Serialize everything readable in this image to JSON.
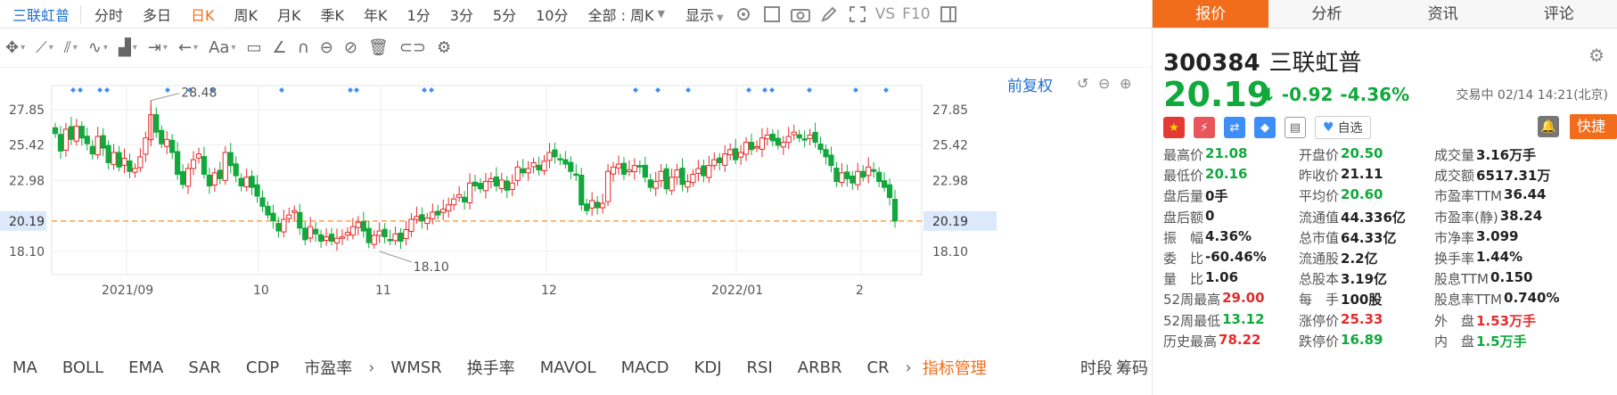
{
  "top": {
    "stock_name": "三联虹普",
    "timeframes": [
      "分时",
      "多日",
      "日K",
      "周K",
      "月K",
      "季K",
      "年K",
      "1分",
      "3分",
      "5分",
      "10分"
    ],
    "active_timeframe": "日K",
    "range_select": "全部 : 周K",
    "display_label": "显示",
    "vs_label": "VS",
    "f10_label": "F10"
  },
  "chart": {
    "adjust_label": "前复权",
    "y_ticks": [
      "27.85",
      "25.42",
      "22.98",
      "20.19",
      "18.10"
    ],
    "x_ticks": [
      "2021/09",
      "10",
      "11",
      "12",
      "2022/01",
      "2"
    ],
    "high_label": "28.48",
    "low_label": "18.10",
    "current_price_label": "20.19"
  },
  "chart_data": {
    "type": "candlestick",
    "ylim": [
      16.5,
      29.5
    ],
    "y_ticks": [
      27.85,
      25.42,
      22.98,
      20.19,
      18.1
    ],
    "x_ticks": [
      "2021/09",
      "10",
      "11",
      "12",
      "2022/01",
      "2"
    ],
    "current_price": 20.19,
    "max": 28.48,
    "min": 18.1,
    "closes": [
      26.2,
      25.0,
      26.5,
      25.8,
      26.7,
      25.9,
      25.5,
      24.8,
      26.0,
      25.2,
      24.2,
      24.9,
      23.9,
      24.5,
      23.6,
      23.8,
      24.6,
      25.9,
      27.5,
      26.3,
      25.5,
      25.8,
      24.9,
      23.4,
      22.7,
      23.8,
      24.4,
      24.8,
      23.4,
      22.6,
      23.5,
      23.1,
      24.9,
      24.0,
      23.3,
      22.6,
      23.2,
      22.5,
      21.9,
      21.2,
      20.6,
      20.2,
      19.5,
      20.3,
      20.6,
      20.9,
      19.7,
      18.9,
      19.8,
      19.3,
      18.8,
      19.1,
      18.8,
      19.0,
      19.1,
      19.4,
      19.8,
      20.1,
      19.5,
      18.7,
      19.2,
      19.5,
      19.1,
      18.9,
      19.3,
      18.8,
      19.6,
      20.3,
      20.5,
      20.2,
      20.4,
      20.8,
      20.6,
      21.0,
      21.3,
      21.7,
      22.0,
      21.5,
      22.8,
      22.6,
      22.4,
      22.9,
      23.1,
      22.6,
      23.0,
      22.3,
      22.8,
      23.9,
      23.5,
      23.8,
      24.2,
      23.7,
      24.3,
      24.9,
      24.6,
      24.4,
      24.1,
      23.6,
      23.4,
      21.3,
      20.9,
      21.6,
      21.1,
      21.4,
      23.6,
      23.9,
      24.1,
      23.4,
      23.7,
      24.0,
      23.9,
      23.2,
      22.5,
      22.9,
      23.6,
      22.4,
      23.2,
      23.7,
      22.7,
      22.9,
      23.4,
      23.8,
      23.3,
      24.0,
      24.4,
      24.2,
      24.8,
      25.1,
      24.4,
      24.9,
      25.6,
      25.1,
      25.3,
      25.9,
      26.1,
      25.7,
      25.4,
      25.6,
      26.0,
      26.3,
      25.9,
      25.8,
      26.1,
      25.6,
      25.1,
      24.6,
      24.0,
      22.9,
      23.5,
      23.1,
      22.8,
      23.6,
      23.2,
      23.9,
      23.6,
      22.9,
      22.5,
      21.8,
      20.19
    ]
  },
  "draw_tools": [
    "move-icon",
    "line-icon",
    "channel-icon",
    "wave-icon",
    "fib-icon",
    "measure-icon",
    "arrow-icon",
    "text-icon",
    "comment-icon",
    "angle-icon",
    "magnet-icon",
    "lock-icon",
    "eye-icon",
    "trash-icon",
    "link-icon",
    "gear-icon"
  ],
  "text_tool_label": "Aa",
  "indicators": [
    "MA",
    "BOLL",
    "EMA",
    "SAR",
    "CDP",
    "市盈率",
    "WMSR",
    "换手率",
    "MAVOL",
    "MACD",
    "KDJ",
    "RSI",
    "ARBR",
    "CR"
  ],
  "indicator_manage": "指标管理",
  "bottom_right": [
    "时段",
    "筹码"
  ],
  "right": {
    "tabs": [
      "报价",
      "分析",
      "资讯",
      "评论"
    ],
    "active_tab": "报价",
    "code": "300384",
    "name": "三联虹普",
    "price": "20.19",
    "arrow": "↓",
    "change": "-0.92",
    "change_pct": "-4.36%",
    "trade_status": "交易中 02/14 14:21(北京)",
    "watch_label": "自选",
    "quick_trade": "快捷交易",
    "quote": [
      [
        {
          "l": "最高价",
          "v": "21.08",
          "c": "g"
        },
        {
          "l": "开盘价",
          "v": "20.50",
          "c": "g"
        },
        {
          "l": "成交量",
          "v": "3.16万手",
          "c": ""
        }
      ],
      [
        {
          "l": "最低价",
          "v": "20.16",
          "c": "g"
        },
        {
          "l": "昨收价",
          "v": "21.11",
          "c": ""
        },
        {
          "l": "成交额",
          "v": "6517.31万",
          "c": ""
        }
      ],
      [
        {
          "l": "盘后量",
          "v": "0手",
          "c": ""
        },
        {
          "l": "平均价",
          "v": "20.60",
          "c": "g"
        },
        {
          "l": "市盈率TTM",
          "v": "36.44",
          "c": ""
        }
      ],
      [
        {
          "l": "盘后额",
          "v": "0",
          "c": ""
        },
        {
          "l": "流通值",
          "v": "44.336亿",
          "c": ""
        },
        {
          "l": "市盈率(静)",
          "v": "38.24",
          "c": ""
        }
      ],
      [
        {
          "l": "振　幅",
          "v": "4.36%",
          "c": ""
        },
        {
          "l": "总市值",
          "v": "64.33亿",
          "c": ""
        },
        {
          "l": "市净率",
          "v": "3.099",
          "c": ""
        }
      ],
      [
        {
          "l": "委　比",
          "v": "-60.46%",
          "c": ""
        },
        {
          "l": "流通股",
          "v": "2.2亿",
          "c": ""
        },
        {
          "l": "换手率",
          "v": "1.44%",
          "c": ""
        }
      ],
      [
        {
          "l": "量　比",
          "v": "1.06",
          "c": ""
        },
        {
          "l": "总股本",
          "v": "3.19亿",
          "c": ""
        },
        {
          "l": "股息TTM",
          "v": "0.150",
          "c": ""
        }
      ],
      [
        {
          "l": "52周最高",
          "v": "29.00",
          "c": "r"
        },
        {
          "l": "每　手",
          "v": "100股",
          "c": ""
        },
        {
          "l": "股息率TTM",
          "v": "0.740%",
          "c": ""
        }
      ],
      [
        {
          "l": "52周最低",
          "v": "13.12",
          "c": "g"
        },
        {
          "l": "涨停价",
          "v": "25.33",
          "c": "r"
        },
        {
          "l": "外　盘",
          "v": "1.53万手",
          "c": "r"
        }
      ],
      [
        {
          "l": "历史最高",
          "v": "78.22",
          "c": "r"
        },
        {
          "l": "跌停价",
          "v": "16.89",
          "c": "g"
        },
        {
          "l": "内　盘",
          "v": "1.5万手",
          "c": "g"
        }
      ]
    ]
  },
  "colors": {
    "accent": "#f26d1b",
    "up": "#e52b2b",
    "down": "#11a83c",
    "link": "#1f6fd0"
  }
}
